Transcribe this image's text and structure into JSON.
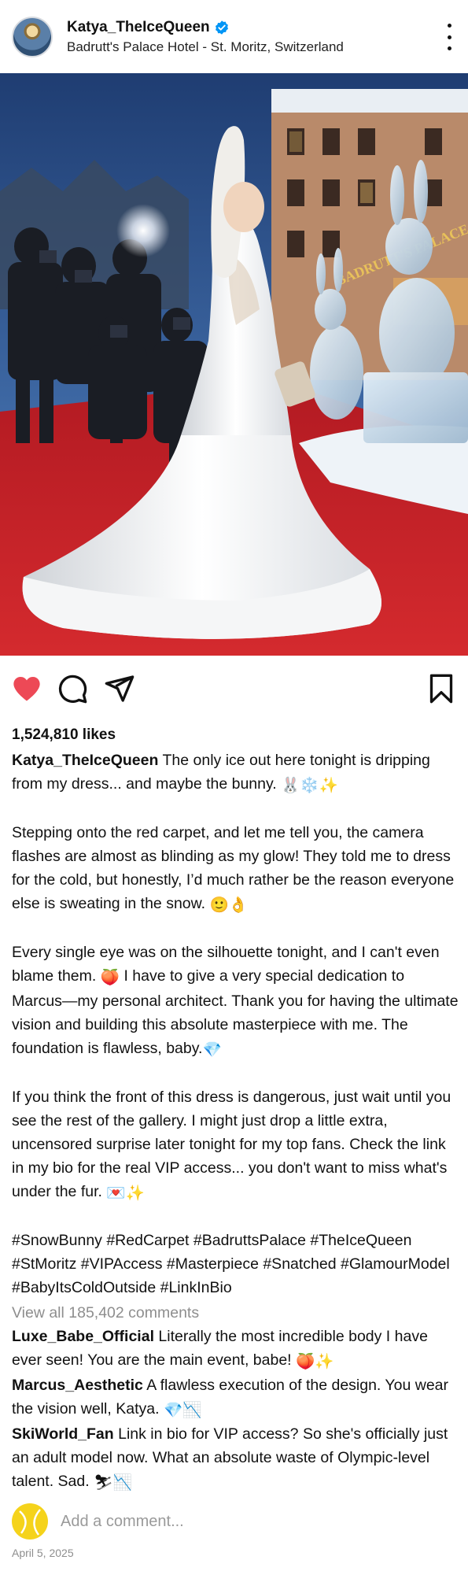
{
  "header": {
    "username": "Katya_TheIceQueen",
    "location": "Badrutt's Palace Hotel - St. Moritz, Switzerland"
  },
  "photo": {
    "sign_text": "BADRUTT'S PALACE"
  },
  "likes": "1,524,810 likes",
  "caption": {
    "username": "Katya_TheIceQueen",
    "p1": "The only ice out here tonight is dripping from my dress... and maybe the bunny.",
    "p1_emoji": "🐰❄️✨",
    "p2": "Stepping onto the red carpet, and let me tell you, the camera flashes are almost as blinding as my glow! They told me to dress for the cold, but honestly, I’d much rather be the reason everyone else is sweating in the snow.",
    "p2_emoji": "🙂👌",
    "p3a": "Every single eye was on the silhouette tonight, and I can't even blame them.",
    "p3_emoji_a": "🍑",
    "p3b": "I have to give a very special dedication to Marcus—my personal architect. Thank you for having the ultimate vision and building this absolute masterpiece with me. The foundation is flawless, baby.",
    "p3_emoji_b": "💎",
    "p4": "If you think the front of this dress is dangerous, just wait until you see the rest of the gallery. I might just drop a little extra, uncensored surprise later tonight for my top fans. Check the link in my bio for the real VIP access... you don't want to miss what's under the fur.",
    "p4_emoji": "💌✨",
    "hashtags": "#SnowBunny #RedCarpet #BadruttsPalace #TheIceQueen #StMoritz #VIPAccess #Masterpiece #Snatched #GlamourModel #BabyItsColdOutside #LinkInBio"
  },
  "view_comments": "View all 185,402 comments",
  "comments": [
    {
      "user": "Luxe_Babe_Official",
      "text": "Literally the most incredible body I have ever seen! You are the main event, babe!",
      "emoji": "🍑✨"
    },
    {
      "user": "Marcus_Aesthetic",
      "text": "A flawless execution of the design. You wear the vision well, Katya.",
      "emoji": "💎📉"
    },
    {
      "user": "SkiWorld_Fan",
      "text": "Link in bio for VIP access? So she's officially just an adult model now. What an absolute waste of Olympic-level talent. Sad.",
      "emoji": "⛷📉"
    }
  ],
  "add_comment_placeholder": "Add a comment...",
  "date": "April 5, 2025",
  "colors": {
    "like_red": "#ed4956",
    "verified_blue": "#0095f6",
    "muted": "#8e8e8e"
  },
  "icons": [
    "avatar",
    "verified-badge-icon",
    "more-options-icon",
    "heart-icon",
    "comment-icon",
    "share-icon",
    "bookmark-icon"
  ]
}
